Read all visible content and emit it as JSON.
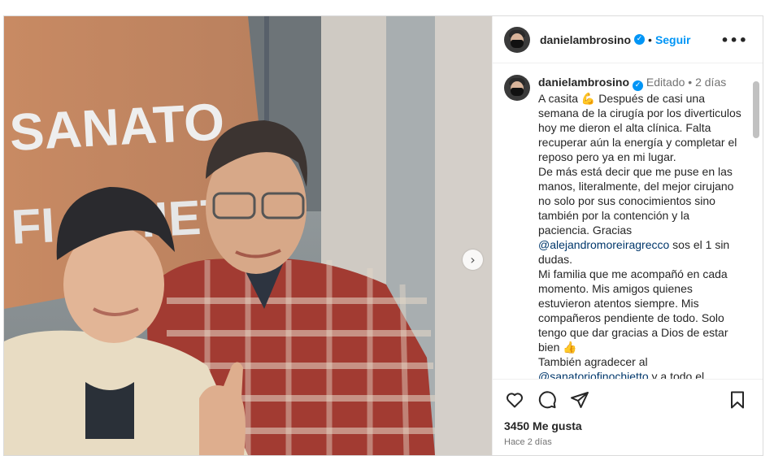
{
  "post": {
    "username": "danielambrosino",
    "follow_label": "Seguir",
    "more_label": "•••"
  },
  "caption": {
    "username": "danielambrosino",
    "edited": "Editado",
    "separator": "•",
    "time": "2 días",
    "text_1": "A casita 💪 Después de casi una semana de la cirugía por los diverticulos hoy me dieron el alta clínica. Falta recuperar aún la energía y completar el reposo pero ya en mi lugar.\nDe más está decir que me puse en las manos, literalmente, del mejor cirujano no solo por sus conocimientos sino también por la contención y la paciencia. Gracias ",
    "mention_1": "@alejandromoreiragrecco",
    "text_2": " sos el 1 sin dudas.\nMi familia que me acompañó en cada momento. Mis amigos quienes estuvieron atentos siempre. Mis compañeros pendiente de todo. Solo tengo que dar gracias a Dios de estar bien 👍\nTambién agradecer al ",
    "mention_2": "@sanatoriofinochietto",
    "text_3": " y a todo el"
  },
  "image": {
    "sign_text_1": "SANATO",
    "sign_text_2": "FI  O HIET"
  },
  "stats": {
    "likes": "3450 Me gusta",
    "date": "Hace 2 días"
  },
  "icons": {
    "like": "heart-icon",
    "comment": "comment-icon",
    "share": "share-icon",
    "save": "bookmark-icon",
    "next": "chevron-right-icon"
  },
  "colors": {
    "accent": "#0095f6",
    "mention": "#00376b"
  }
}
